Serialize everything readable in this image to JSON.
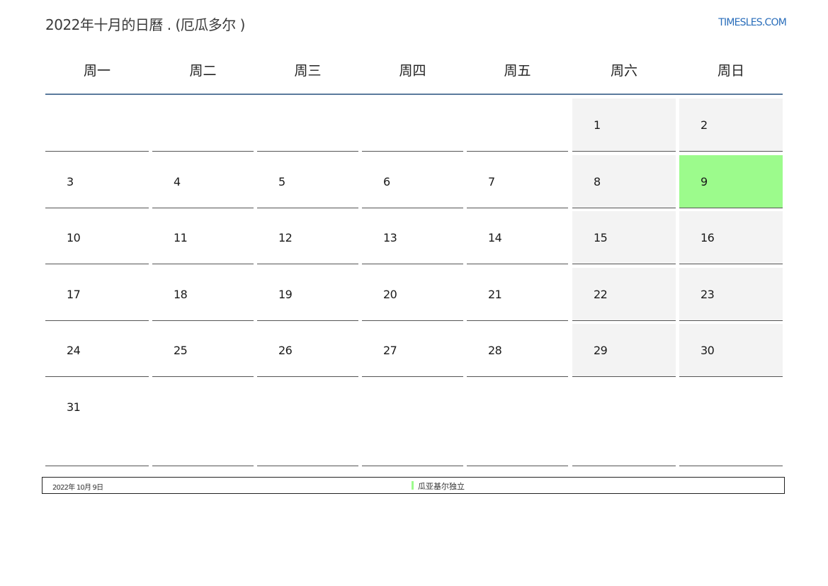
{
  "header": {
    "title": "2022年十月的日曆 . (厄瓜多尔 )",
    "site_link": "TIMESLES.COM"
  },
  "calendar": {
    "weekdays": [
      "周一",
      "周二",
      "周三",
      "周四",
      "周五",
      "周六",
      "周日"
    ],
    "weeks": [
      [
        "",
        "",
        "",
        "",
        "",
        "1",
        "2"
      ],
      [
        "3",
        "4",
        "5",
        "6",
        "7",
        "8",
        "9"
      ],
      [
        "10",
        "11",
        "12",
        "13",
        "14",
        "15",
        "16"
      ],
      [
        "17",
        "18",
        "19",
        "20",
        "21",
        "22",
        "23"
      ],
      [
        "24",
        "25",
        "26",
        "27",
        "28",
        "29",
        "30"
      ],
      [
        "31",
        "",
        "",
        "",
        "",
        "",
        ""
      ]
    ],
    "highlighted_day": "9"
  },
  "colors": {
    "holiday_highlight": "#9cfb8c",
    "weekend_bg": "#f3f3f3",
    "header_rule": "#5b7a9d",
    "link": "#2a6ebb"
  },
  "footer": {
    "holiday_date": "2022年 10月 9日",
    "holiday_name": "瓜亚基尔独立"
  }
}
